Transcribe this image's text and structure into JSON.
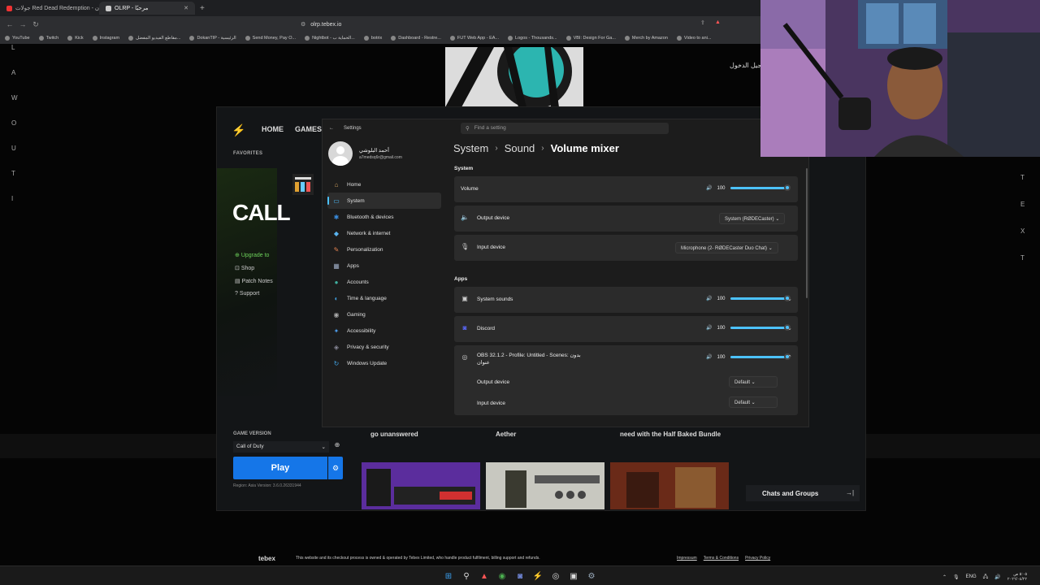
{
  "browser": {
    "tabs": [
      {
        "title": "جولات Red Dead Redemption - وحصان...",
        "active": false
      },
      {
        "title": "OLRP - مرحبًا",
        "active": true
      }
    ],
    "new_tab": "+",
    "url": "olrp.tebex.io",
    "bookmarks": [
      "YouTube",
      "Twitch",
      "Kick",
      "Instagram",
      "مقاطع الفيديو المفضل...",
      "DokanTIP - الرئيسية",
      "Send Money, Pay O...",
      "Nightbot - الحماية ب...",
      "botrix",
      "Dashboard - Restre...",
      "FUT Web App - EA...",
      "Logos - Thousands...",
      "VBI: Design For Ga...",
      "Merch by Amazon",
      "Video to ani..."
    ]
  },
  "webpage": {
    "left_letters": [
      "L",
      "A",
      "W",
      "O",
      "U",
      "T",
      "I"
    ],
    "right_letters": [
      "T",
      "E",
      "X",
      "T"
    ],
    "login_text": "تسجيل الدخول",
    "footer": {
      "brand": "tebex",
      "text": "This website and its checkout process is owned & operated by Tebex Limited, who handle product fulfilment, billing support and refunds.",
      "links": [
        "Impressum",
        "Terms & Conditions",
        "Privacy Policy"
      ]
    }
  },
  "battlenet": {
    "nav": [
      "HOME",
      "GAMES"
    ],
    "favorites": "FAVORITES",
    "game_title": "CALL",
    "links": [
      "Upgrade to",
      "Shop",
      "Patch Notes",
      "Support"
    ],
    "game_version_label": "GAME VERSION",
    "game_version_value": "Call of Duty",
    "play_label": "Play",
    "region": "Region: Asia   Version: 3.6.0.26331944",
    "news": [
      {
        "title": "go unanswered"
      },
      {
        "title": "Aether"
      },
      {
        "title": "need with the Half Baked Bundle"
      }
    ],
    "chats_label": "Chats and Groups"
  },
  "settings": {
    "window_title": "Settings",
    "search_placeholder": "Find a setting",
    "profile": {
      "name": "أحمد البلوشي",
      "email": "a7medsq6r@gmail.com"
    },
    "nav": [
      {
        "label": "Home",
        "icon": "home-icon",
        "glyph": "⌂",
        "color": "#d0a060",
        "selected": false
      },
      {
        "label": "System",
        "icon": "monitor-icon",
        "glyph": "▭",
        "color": "#4cc2ff",
        "selected": true
      },
      {
        "label": "Bluetooth & devices",
        "icon": "bluetooth-icon",
        "glyph": "✱",
        "color": "#3a8de0",
        "selected": false
      },
      {
        "label": "Network & internet",
        "icon": "wifi-icon",
        "glyph": "◆",
        "color": "#5ab4f0",
        "selected": false
      },
      {
        "label": "Personalization",
        "icon": "brush-icon",
        "glyph": "✎",
        "color": "#e08050",
        "selected": false
      },
      {
        "label": "Apps",
        "icon": "apps-icon",
        "glyph": "▦",
        "color": "#9aa8c0",
        "selected": false
      },
      {
        "label": "Accounts",
        "icon": "account-icon",
        "glyph": "●",
        "color": "#40b0a0",
        "selected": false
      },
      {
        "label": "Time & language",
        "icon": "globe-icon",
        "glyph": "◐",
        "color": "#40a0e0",
        "selected": false
      },
      {
        "label": "Gaming",
        "icon": "controller-icon",
        "glyph": "◉",
        "color": "#aaaaaa",
        "selected": false
      },
      {
        "label": "Accessibility",
        "icon": "accessibility-icon",
        "glyph": "✦",
        "color": "#4c9ae8",
        "selected": false
      },
      {
        "label": "Privacy & security",
        "icon": "shield-icon",
        "glyph": "◈",
        "color": "#8a8a9a",
        "selected": false
      },
      {
        "label": "Windows Update",
        "icon": "update-icon",
        "glyph": "↻",
        "color": "#40a0e0",
        "selected": false
      }
    ],
    "breadcrumb": [
      "System",
      "Sound",
      "Volume mixer"
    ],
    "system_section": "System",
    "volume_label": "Volume",
    "volume_value": "100",
    "volume_level": 1.0,
    "output_device_label": "Output device",
    "output_device_value": "System (RØDECaster)",
    "input_device_label": "Input device",
    "input_device_value": "Microphone (2- RØDECaster Duo Chat)",
    "apps_section": "Apps",
    "apps": [
      {
        "name": "System sounds",
        "volume": "100",
        "level": 1.0,
        "icon": "speaker-box-icon",
        "glyph": "▣"
      },
      {
        "name": "Discord",
        "volume": "100",
        "level": 1.0,
        "icon": "discord-icon",
        "glyph": "◙"
      },
      {
        "name": "OBS 32.1.2 - Profile: Untitled - Scenes: بدون عنوان",
        "volume": "100",
        "level": 1.0,
        "icon": "obs-icon",
        "glyph": "◎"
      }
    ],
    "obs_output_label": "Output device",
    "obs_output_value": "Default",
    "obs_input_label": "Input device",
    "obs_input_value": "Default"
  },
  "taskbar": {
    "language": "ENG",
    "time": "٥:٠٥ ص",
    "date": "٢٠٢٦/٠٤/٢٢"
  }
}
